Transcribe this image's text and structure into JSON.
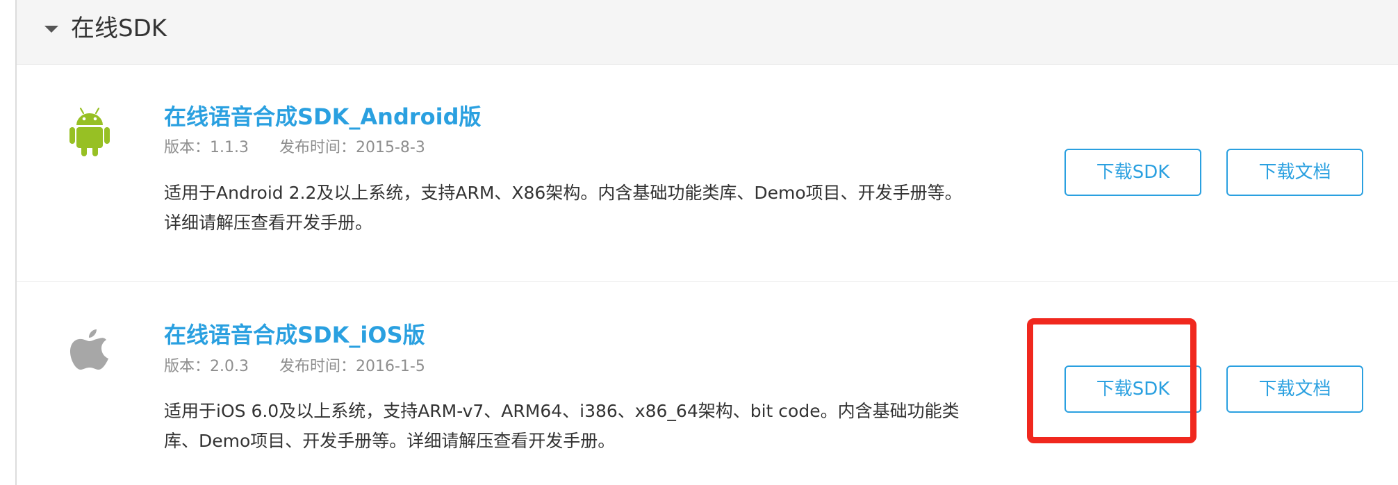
{
  "section": {
    "title": "在线SDK"
  },
  "items": [
    {
      "platform_icon": "android-icon",
      "title": "在线语音合成SDK_Android版",
      "version_label": "版本：1.1.3",
      "date_label": "发布时间：2015-8-3",
      "description": "适用于Android 2.2及以上系统，支持ARM、X86架构。内含基础功能类库、Demo项目、开发手册等。详细请解压查看开发手册。",
      "download_sdk_label": "下载SDK",
      "download_doc_label": "下载文档"
    },
    {
      "platform_icon": "apple-icon",
      "title": "在线语音合成SDK_iOS版",
      "version_label": "版本：2.0.3",
      "date_label": "发布时间：2016-1-5",
      "description": "适用于iOS 6.0及以上系统，支持ARM-v7、ARM64、i386、x86_64架构、bit code。内含基础功能类库、Demo项目、开发手册等。详细请解压查看开发手册。",
      "download_sdk_label": "下载SDK",
      "download_doc_label": "下载文档"
    }
  ],
  "colors": {
    "accent": "#2aa0e0",
    "android_green": "#97c024",
    "apple_gray": "#a7a7a7",
    "highlight_red": "#f0281e"
  }
}
